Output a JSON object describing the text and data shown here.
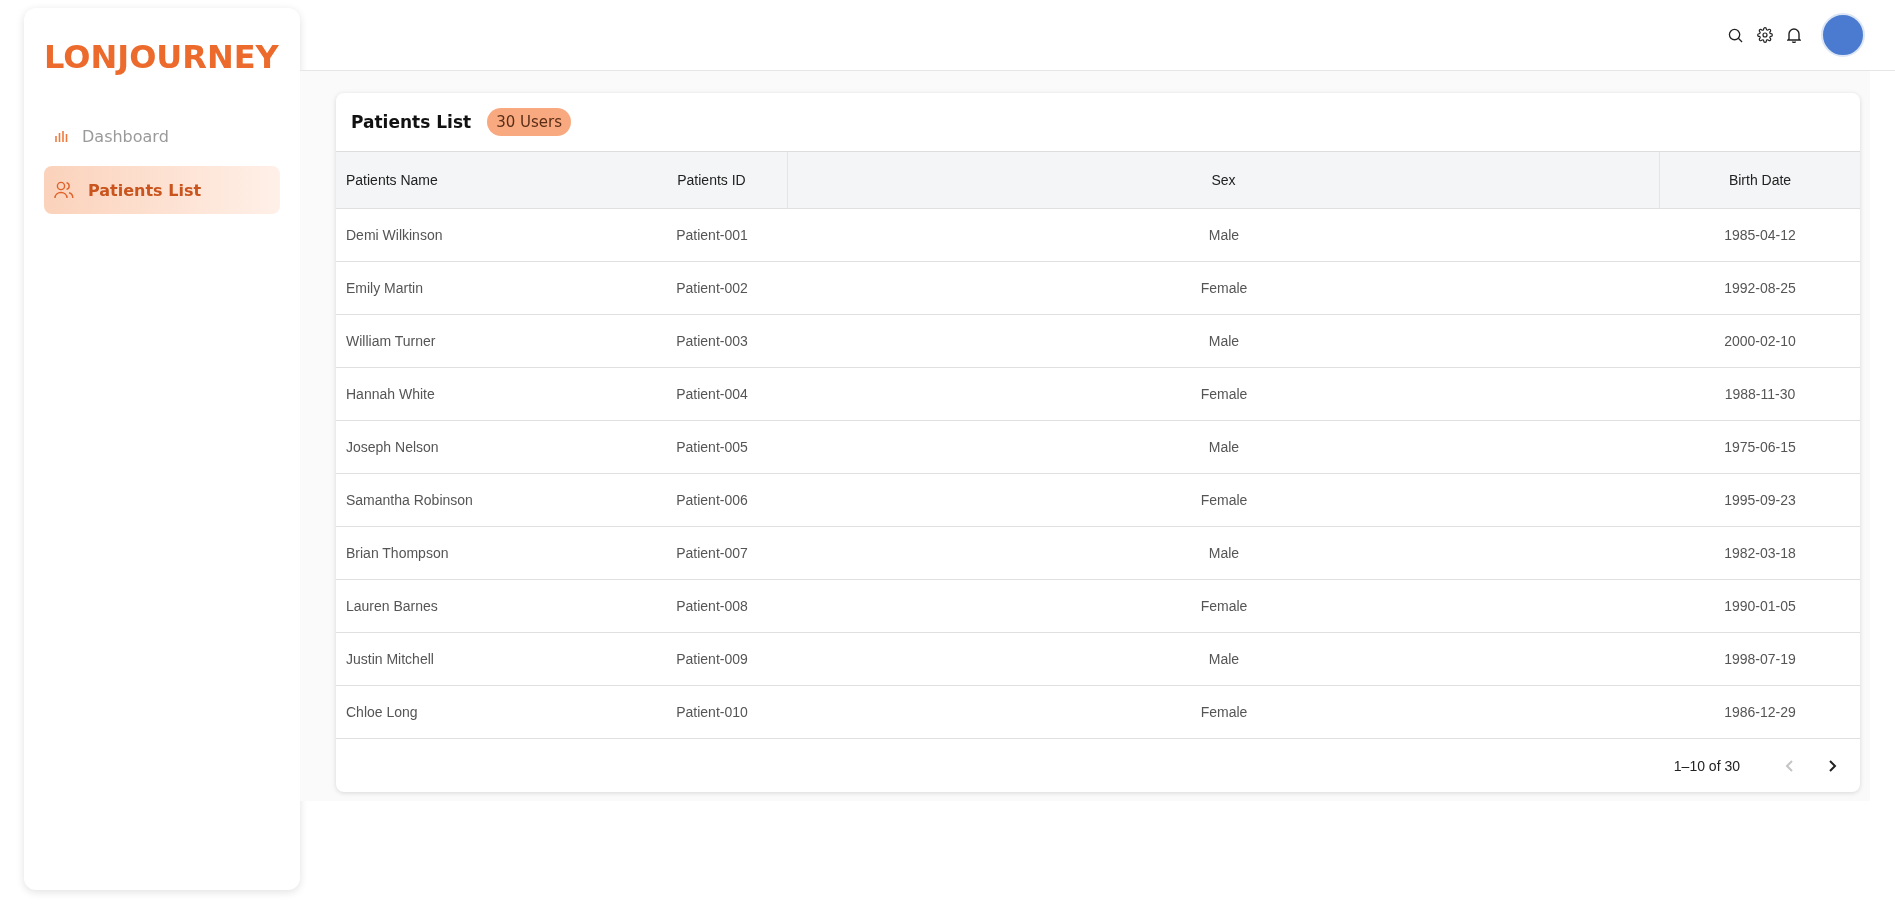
{
  "logo": "LONJOURNEY",
  "sidebar": {
    "items": [
      {
        "label": "Dashboard",
        "selected": false
      },
      {
        "label": "Patients List",
        "selected": true
      }
    ]
  },
  "card": {
    "title": "Patients List",
    "badge": "30 Users"
  },
  "table": {
    "columns": [
      "Patients Name",
      "Patients ID",
      "Sex",
      "Birth Date"
    ],
    "rows": [
      [
        "Demi Wilkinson",
        "Patient-001",
        "Male",
        "1985-04-12"
      ],
      [
        "Emily Martin",
        "Patient-002",
        "Female",
        "1992-08-25"
      ],
      [
        "William Turner",
        "Patient-003",
        "Male",
        "2000-02-10"
      ],
      [
        "Hannah White",
        "Patient-004",
        "Female",
        "1988-11-30"
      ],
      [
        "Joseph Nelson",
        "Patient-005",
        "Male",
        "1975-06-15"
      ],
      [
        "Samantha Robinson",
        "Patient-006",
        "Female",
        "1995-09-23"
      ],
      [
        "Brian Thompson",
        "Patient-007",
        "Male",
        "1982-03-18"
      ],
      [
        "Lauren Barnes",
        "Patient-008",
        "Female",
        "1990-01-05"
      ],
      [
        "Justin Mitchell",
        "Patient-009",
        "Male",
        "1998-07-19"
      ],
      [
        "Chloe Long",
        "Patient-010",
        "Female",
        "1986-12-29"
      ]
    ]
  },
  "pagination": {
    "range": "1–10 of 30",
    "prev_disabled": true,
    "next_disabled": false
  }
}
